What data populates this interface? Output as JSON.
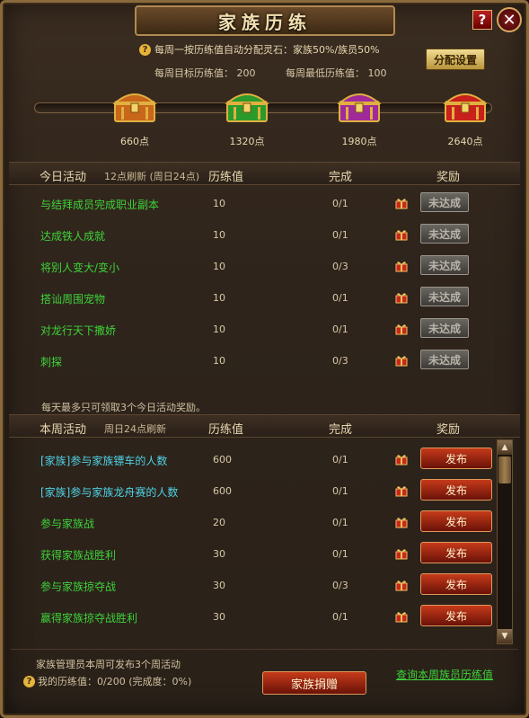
{
  "window": {
    "title": "家族历练",
    "help_label": "?",
    "close_label": "✕"
  },
  "info": {
    "help_icon": "?",
    "text": "每周一按历练值自动分配灵石：家族50%/族员50%",
    "weekly_target": "每周目标历练值：  200",
    "weekly_min": "每周最低历练值：  100",
    "alloc_button": "分配设置"
  },
  "progress": {
    "fraction": 0.0
  },
  "chests": [
    {
      "label": "660点",
      "color": "#c8661a"
    },
    {
      "label": "1320点",
      "color": "#2a9a2a"
    },
    {
      "label": "1980点",
      "color": "#a02a9a"
    },
    {
      "label": "2640点",
      "color": "#c8201a"
    }
  ],
  "daily": {
    "header": "今日活动",
    "refresh": "12点刷新 (周日24点)",
    "col_value": "历练值",
    "col_progress": "完成",
    "col_reward": "奖励",
    "rows": [
      {
        "name": "与结拜成员完成职业副本",
        "value": "10",
        "progress": "0/1",
        "button": "未达成"
      },
      {
        "name": "达成铁人成就",
        "value": "10",
        "progress": "0/1",
        "button": "未达成"
      },
      {
        "name": "将别人变大/变小",
        "value": "10",
        "progress": "0/3",
        "button": "未达成"
      },
      {
        "name": "搭讪周围宠物",
        "value": "10",
        "progress": "0/1",
        "button": "未达成"
      },
      {
        "name": "对龙行天下撒娇",
        "value": "10",
        "progress": "0/1",
        "button": "未达成"
      },
      {
        "name": "刺探",
        "value": "10",
        "progress": "0/3",
        "button": "未达成"
      }
    ],
    "note": "每天最多只可领取3个今日活动奖励。"
  },
  "weekly": {
    "header": "本周活动",
    "refresh": "周日24点刷新",
    "col_value": "历练值",
    "col_progress": "完成",
    "col_reward": "奖励",
    "rows": [
      {
        "name": "[家族]参与家族镖车的人数",
        "value": "600",
        "progress": "0/1",
        "button": "发布",
        "style": "cyan"
      },
      {
        "name": "[家族]参与家族龙舟赛的人数",
        "value": "600",
        "progress": "0/1",
        "button": "发布",
        "style": "cyan"
      },
      {
        "name": "参与家族战",
        "value": "20",
        "progress": "0/1",
        "button": "发布",
        "style": "green"
      },
      {
        "name": "获得家族战胜利",
        "value": "30",
        "progress": "0/1",
        "button": "发布",
        "style": "green"
      },
      {
        "name": "参与家族掠夺战",
        "value": "30",
        "progress": "0/3",
        "button": "发布",
        "style": "green"
      },
      {
        "name": "赢得家族掠夺战胜利",
        "value": "30",
        "progress": "0/1",
        "button": "发布",
        "style": "green"
      }
    ]
  },
  "footer": {
    "manager_note": "家族管理员本周可发布3个周活动",
    "my_value": "我的历练值：0/200 (完成度：0%)",
    "donate_button": "家族捐赠",
    "query_link": "查询本周族员历练值"
  }
}
